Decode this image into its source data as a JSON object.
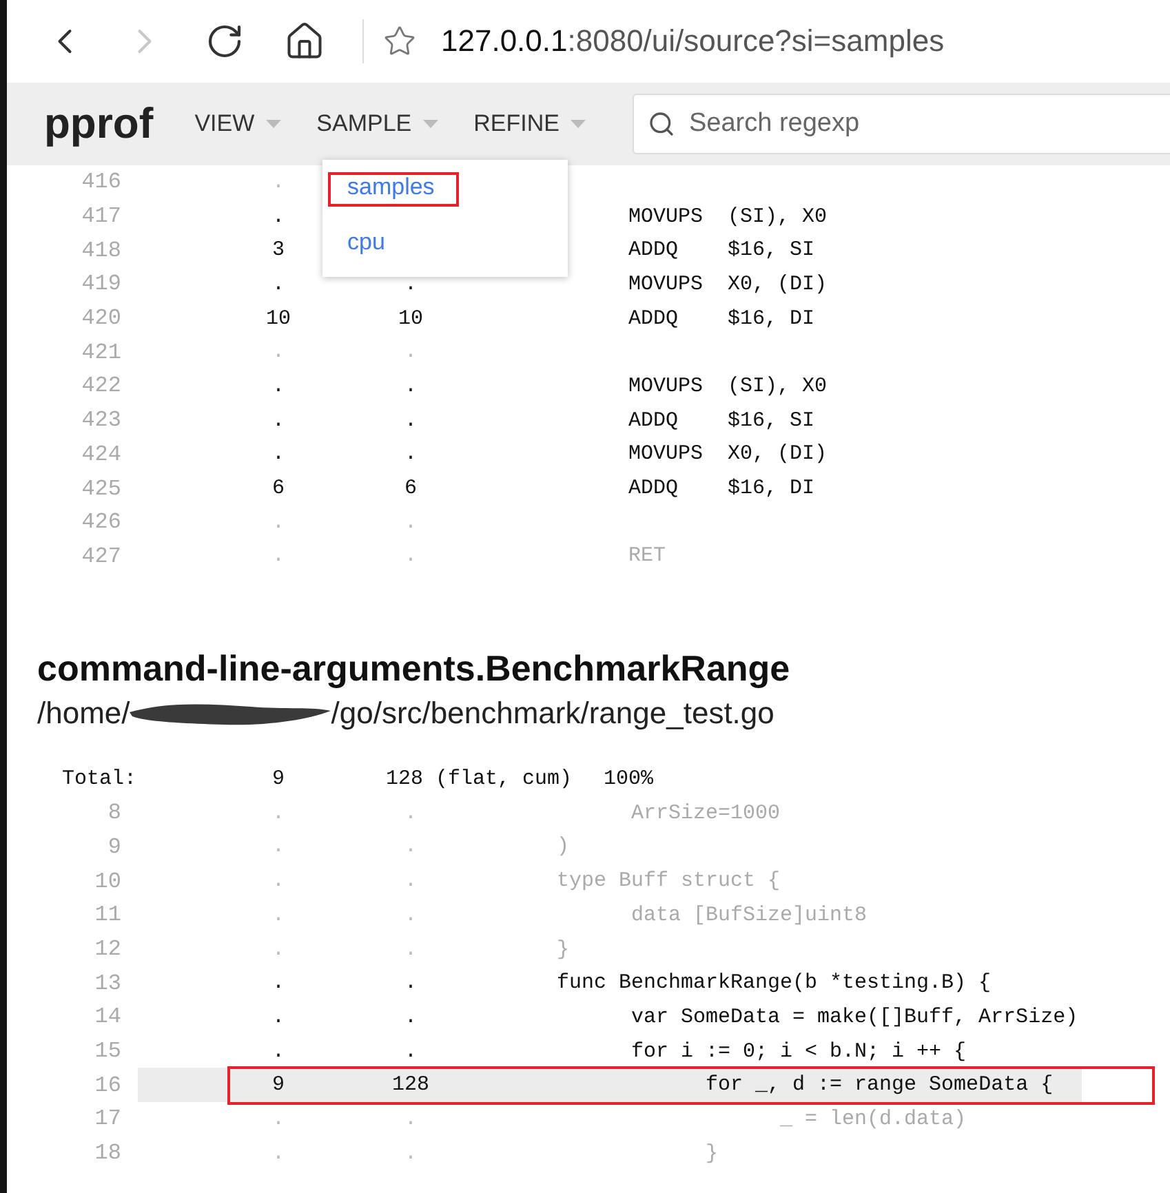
{
  "browser": {
    "back": {
      "disabled": false
    },
    "forward": {
      "disabled": true
    },
    "url_host": "127.0.0.1",
    "url_rest": ":8080/ui/source?si=samples"
  },
  "toolbar": {
    "logo": "pprof",
    "menus": [
      {
        "label": "VIEW"
      },
      {
        "label": "SAMPLE"
      },
      {
        "label": "REFINE"
      }
    ],
    "search": {
      "placeholder": "Search regexp"
    }
  },
  "sample_menu": {
    "items": [
      {
        "label": "samples",
        "annotated": true
      },
      {
        "label": "cpu",
        "annotated": false
      }
    ]
  },
  "asm_rows": [
    {
      "num": "416",
      "flat": ".",
      "dim": true
    },
    {
      "num": "417",
      "flat": ".",
      "code": "MOVUPS  (SI), X0",
      "dim": false
    },
    {
      "num": "418",
      "flat": "3",
      "code": "ADDQ    $16, SI",
      "dim": false
    },
    {
      "num": "419",
      "flat": ".",
      "cum": ".",
      "code": "MOVUPS  X0, (DI)",
      "dim": false
    },
    {
      "num": "420",
      "flat": "10",
      "cum": "10",
      "code": "ADDQ    $16, DI",
      "dim": false
    },
    {
      "num": "421",
      "flat": ".",
      "cum": ".",
      "dim": true
    },
    {
      "num": "422",
      "flat": ".",
      "cum": ".",
      "code": "MOVUPS  (SI), X0",
      "dim": false
    },
    {
      "num": "423",
      "flat": ".",
      "cum": ".",
      "code": "ADDQ    $16, SI",
      "dim": false
    },
    {
      "num": "424",
      "flat": ".",
      "cum": ".",
      "code": "MOVUPS  X0, (DI)",
      "dim": false
    },
    {
      "num": "425",
      "flat": "6",
      "cum": "6",
      "code": "ADDQ    $16, DI",
      "dim": false
    },
    {
      "num": "426",
      "flat": ".",
      "cum": ".",
      "dim": true
    },
    {
      "num": "427",
      "flat": ".",
      "cum": ".",
      "code": "RET",
      "dim": true
    }
  ],
  "function": {
    "title": "command-line-arguments.BenchmarkRange",
    "path_start": "/home/",
    "path_redacted": true,
    "path_end": "/go/src/benchmark/range_test.go"
  },
  "total": {
    "label": "Total:",
    "flat": "9",
    "cum": "128 (flat, cum)",
    "percent": "100%"
  },
  "source_rows": [
    {
      "num": "8",
      "flat": ".",
      "cum": ".",
      "code": "\tArrSize=1000",
      "dim": true,
      "highlighted": false,
      "annotated": false
    },
    {
      "num": "9",
      "flat": ".",
      "cum": ".",
      "code": ")",
      "dim": true,
      "highlighted": false,
      "annotated": false
    },
    {
      "num": "10",
      "flat": ".",
      "cum": ".",
      "code": "type Buff struct {",
      "dim": true,
      "highlighted": false,
      "annotated": false
    },
    {
      "num": "11",
      "flat": ".",
      "cum": ".",
      "code": "\tdata [BufSize]uint8",
      "dim": true,
      "highlighted": false,
      "annotated": false
    },
    {
      "num": "12",
      "flat": ".",
      "cum": ".",
      "code": "}",
      "dim": true,
      "highlighted": false,
      "annotated": false
    },
    {
      "num": "13",
      "flat": ".",
      "cum": ".",
      "code": "func BenchmarkRange(b *testing.B) {",
      "dim": false,
      "highlighted": false,
      "annotated": false
    },
    {
      "num": "14",
      "flat": ".",
      "cum": ".",
      "code": "\tvar SomeData = make([]Buff, ArrSize)",
      "dim": false,
      "highlighted": false,
      "annotated": false
    },
    {
      "num": "15",
      "flat": ".",
      "cum": ".",
      "code": "\tfor i := 0; i < b.N; i ++ {",
      "dim": false,
      "highlighted": false,
      "annotated": false
    },
    {
      "num": "16",
      "flat": "9",
      "cum": "128",
      "code": "\t\tfor _, d := range SomeData {",
      "dim": false,
      "highlighted": true,
      "annotated": true
    },
    {
      "num": "17",
      "flat": ".",
      "cum": ".",
      "code": "\t\t\t_ = len(d.data)",
      "dim": true,
      "highlighted": false,
      "annotated": false
    },
    {
      "num": "18",
      "flat": ".",
      "cum": ".",
      "code": "\t\t}",
      "dim": true,
      "highlighted": false,
      "annotated": false
    }
  ]
}
